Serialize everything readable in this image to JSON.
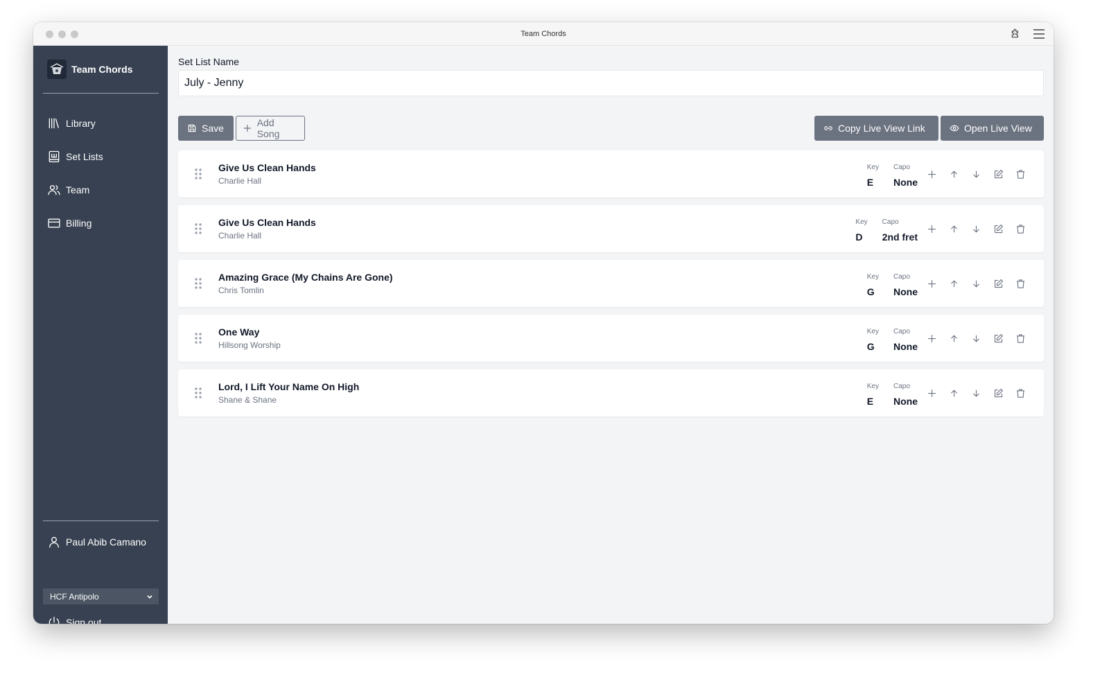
{
  "window": {
    "title": "Team Chords"
  },
  "sidebar": {
    "brand": "Team Chords",
    "nav": [
      {
        "label": "Library",
        "icon": "library-icon"
      },
      {
        "label": "Set Lists",
        "icon": "set-lists-icon"
      },
      {
        "label": "Team",
        "icon": "team-icon"
      },
      {
        "label": "Billing",
        "icon": "credit-card-icon"
      }
    ],
    "user_name": "Paul Abib Camano",
    "team_selected": "HCF Antipolo",
    "sign_out": "Sign out"
  },
  "form": {
    "set_list_label": "Set List Name",
    "set_list_value": "July - Jenny"
  },
  "toolbar": {
    "save": "Save",
    "add_song": "Add Song",
    "copy_link": "Copy Live View Link",
    "open_live": "Open Live View"
  },
  "labels": {
    "key": "Key",
    "capo": "Capo"
  },
  "songs": [
    {
      "title": "Give Us Clean Hands",
      "artist": "Charlie Hall",
      "key": "E",
      "capo": "None"
    },
    {
      "title": "Give Us Clean Hands",
      "artist": "Charlie Hall",
      "key": "D",
      "capo": "2nd fret"
    },
    {
      "title": "Amazing Grace (My Chains Are Gone)",
      "artist": "Chris Tomlin",
      "key": "G",
      "capo": "None"
    },
    {
      "title": "One Way",
      "artist": "Hillsong Worship",
      "key": "G",
      "capo": "None"
    },
    {
      "title": "Lord, I Lift Your Name On High",
      "artist": "Shane & Shane",
      "key": "E",
      "capo": "None"
    }
  ]
}
